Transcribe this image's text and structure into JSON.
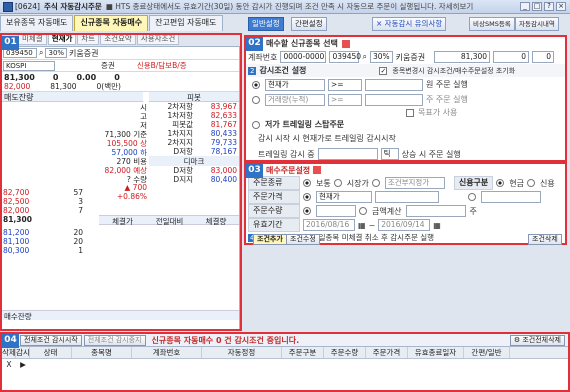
{
  "window": {
    "id": "[0624]",
    "title": "주식 자동감시주문",
    "notice": "■ HTS 종료상태에서도 유효기간(30일) 동안 감시가 진행되며 조건 만족 시 자동으로 주문이 실행됩니다. 자세히보기"
  },
  "tabs": [
    "보유종목 자동매도",
    "신규종목 자동매수",
    "잔고편입 자동매도"
  ],
  "subtabs": [
    "미체결",
    "현재가",
    "차트",
    "조건요약",
    "사용자조건"
  ],
  "symbol": {
    "account": "039450",
    "search_icon": "search-icon",
    "market": "30%",
    "name": "키움증권",
    "board": "KOSPI",
    "type": "증권",
    "status": "신용B/담보B/증"
  },
  "price": {
    "current": "81,300",
    "change": "0",
    "change_pct": "0.00",
    "volume": "0",
    "diff": "82,000",
    "prev": "81,300",
    "vol2": "0(백만)"
  },
  "quote_header": "매도잔량",
  "quote_sell": [
    {
      "p": "82,700",
      "q": "57"
    },
    {
      "p": "82,500",
      "q": "3"
    },
    {
      "p": "82,000",
      "q": "7"
    },
    {
      "p": "81,300",
      "q": ""
    },
    {
      "p": "",
      "q": ""
    }
  ],
  "quote_buy": [
    {
      "p": "81,200",
      "q": "20"
    },
    {
      "p": "81,100",
      "q": "20"
    },
    {
      "p": "80,300",
      "q": "1"
    }
  ],
  "info_left": [
    {
      "k": "시",
      "v": ""
    },
    {
      "k": "고",
      "v": ""
    },
    {
      "k": "저",
      "v": ""
    },
    {
      "k": "71,300",
      "v": "기준"
    },
    {
      "k": "105,500",
      "v": "상"
    },
    {
      "k": "57,000",
      "v": "하"
    },
    {
      "k": "270",
      "v": "비용"
    },
    {
      "k": "82,000",
      "v": "예상"
    },
    {
      "k": "?",
      "v": "수량"
    },
    {
      "k": "▲ 700",
      "v": "+0.86%"
    }
  ],
  "pivot_title": "피봇",
  "pivot": [
    {
      "k": "2차저항",
      "v": "83,967"
    },
    {
      "k": "1차저항",
      "v": "82,633"
    },
    {
      "k": "피봇값",
      "v": "81,767"
    },
    {
      "k": "1차지지",
      "v": "80,433"
    },
    {
      "k": "2차지지",
      "v": "79,733"
    },
    {
      "k": "D저항",
      "v": "78,167"
    },
    {
      "k": "",
      "v": "디마크"
    },
    {
      "k": "D저항",
      "v": "83,000"
    },
    {
      "k": "D지지",
      "v": "80,400"
    }
  ],
  "trade_header": [
    "체결가",
    "전일대비",
    "체결량"
  ],
  "sell_balance_label": "매수잔량",
  "right_top": {
    "btn1": "일반설정",
    "btn2": "간편설정",
    "btn3": "자동감시 유의사항",
    "btn4": "비상SMS등록",
    "btn5": "자동감시내역"
  },
  "p02": {
    "title": "매수할 신규종목 선택",
    "account": "0000-0000",
    "code": "039450",
    "pct": "30%",
    "name": "키움증권",
    "price": "81,300",
    "qty": "0",
    "qty_unit": "0",
    "cond_title": "감시조건 설정",
    "cond_check": "종목변경시 감시조건/매수주문설정 초기화",
    "row1_sel": "현재가",
    "row1_op": ">=",
    "row1_unit": "원 주문 실행",
    "row2_sel": "거래량(누적)",
    "row2_op": ">=",
    "row2_unit": "주 주문 실행",
    "target_label": "목표가 사용",
    "trailing_title": "저가 트레일링 스탑주문",
    "trailing_desc": "감시 시작 시 현재가로 트레일링 감시시작",
    "trailing_label": "트레일링 감시 중",
    "trailing_unit": "틱",
    "trailing_after": "상승 시 주문 실행"
  },
  "p03": {
    "title": "매수주문설정",
    "type_label": "주문종류",
    "r1": "보통",
    "r2": "시장가",
    "r3": "조건부지정가",
    "credit_label": "신용구분",
    "c1": "현금",
    "c2": "신용",
    "price_label": "주문가격",
    "price_sel": "현재가",
    "qty_label": "주문수량",
    "qty_note": "금액계산",
    "qty_unit": "주",
    "period_label": "유효기간",
    "date_from": "2016/08/16",
    "date_to": "2016/09/14",
    "note": "조건 만족시 동일종목 미체결 취소 후 감시주문 실행",
    "btn_add": "조건추가",
    "btn_edit": "조건수정",
    "btn_delete": "조건삭제"
  },
  "bottom": {
    "all_label": "전체조건 감시시작",
    "all_stop": "전체조건 감시중지",
    "status": "신규종목 자동매수 0 건 감시조건 중입니다.",
    "btn_reset": "조건전체삭제"
  },
  "grid_cols": [
    "삭제",
    "감시",
    "상태",
    "종목명",
    "계좌번호",
    "자동정정",
    "주문구분",
    "주문수량",
    "주문가격",
    "유효종료일자",
    "간편/일반"
  ],
  "grid_row": [
    "X",
    "▶"
  ]
}
